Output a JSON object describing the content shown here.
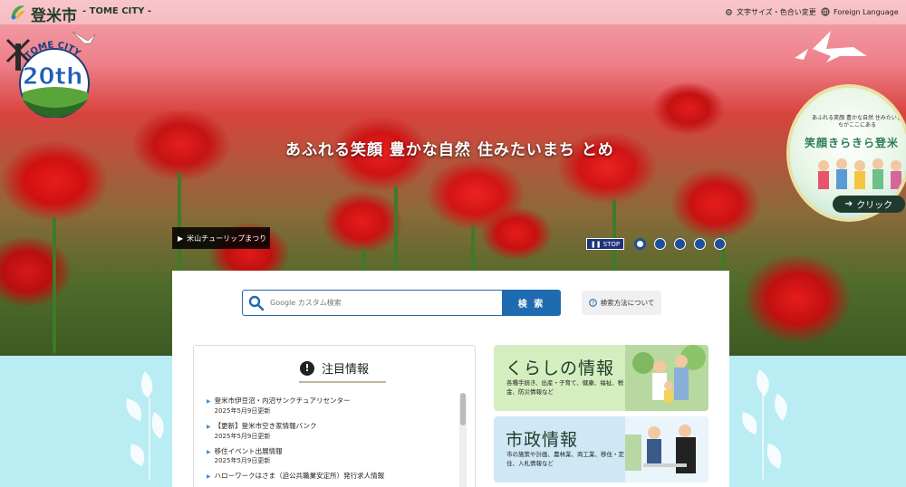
{
  "site": {
    "name": "登米市",
    "subtitle": "- TOME CITY -"
  },
  "topnav": {
    "text_size_label": "文字サイズ・色合い変更",
    "foreign_label": "Foreign Language"
  },
  "anniversary": {
    "arc_text": "TOME CITY",
    "number": "20th"
  },
  "hero": {
    "tagline": "あふれる笑顔 豊かな自然 住みたいまち とめ",
    "caption": "米山チューリップまつり",
    "stop_label": "STOP",
    "slides": 5,
    "active_slide": 1
  },
  "promo": {
    "small_text": "あふれる笑顔 豊かな自然 住みたいまちがここにある",
    "title": "笑顔きらきら登米",
    "click_label": "クリック"
  },
  "search": {
    "placeholder": "Google カスタム検索",
    "button_label": "検 索",
    "help_label": "検索方法について"
  },
  "news": {
    "heading": "注目情報",
    "items": [
      {
        "title": "登米市伊豆沼・内沼サンクチュアリセンター",
        "date": "2025年5月9日更新"
      },
      {
        "title": "【更新】登米市空き家情報バンク",
        "date": "2025年5月9日更新"
      },
      {
        "title": "移住イベント出展情報",
        "date": "2025年5月9日更新"
      },
      {
        "title": "ハローワークはさま（迫公共職業安定所）発行求人情報",
        "date": ""
      }
    ]
  },
  "cards": [
    {
      "title": "くらしの情報",
      "desc": "各種手続き、出産・子育て、健康、福祉、税金、防災情報など",
      "bg": "#d5eec0"
    },
    {
      "title": "市政情報",
      "desc": "市の施策や計画、農林業、商工業、移住・定住、入札情報など",
      "bg": "#cfe8f6"
    }
  ],
  "colors": {
    "accent": "#1f6bb0",
    "stop_bg": "#20337a",
    "dot": "#1d4f9a"
  }
}
